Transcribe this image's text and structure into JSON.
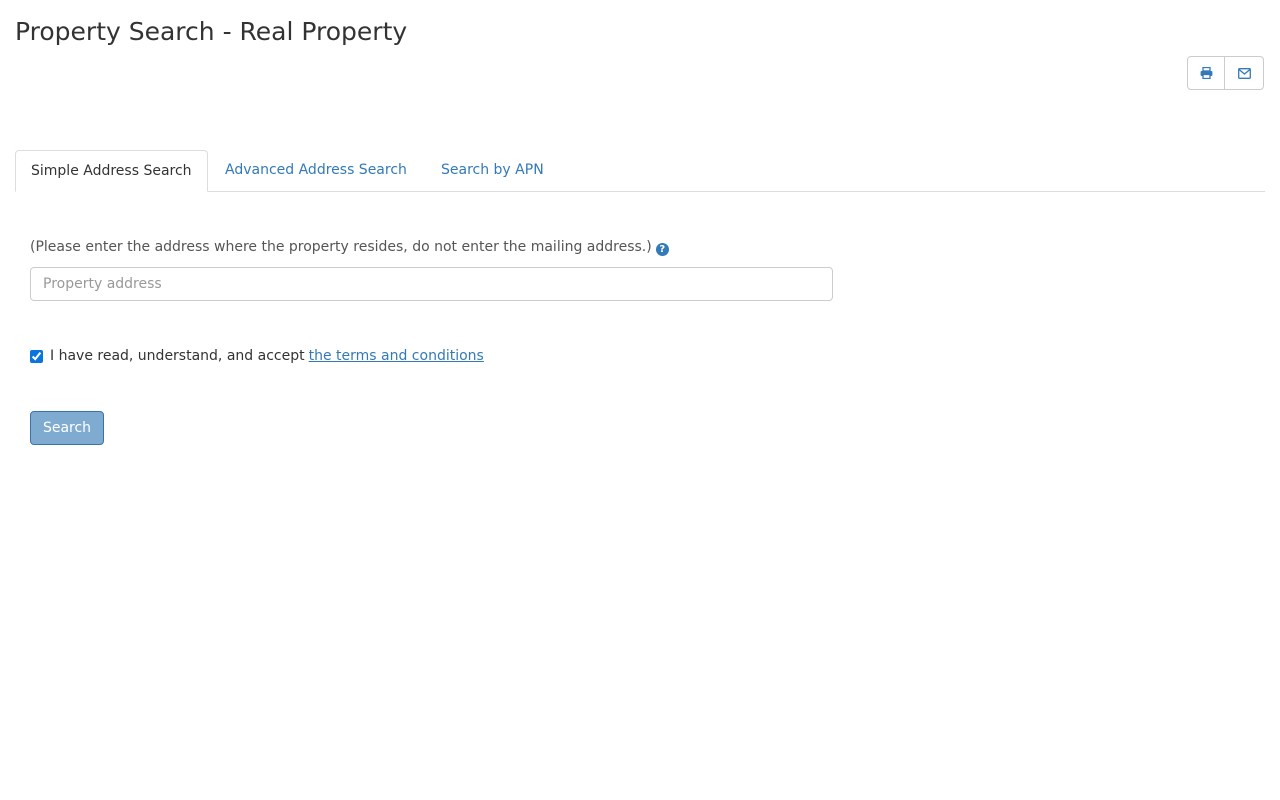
{
  "page": {
    "title": "Property Search - Real Property"
  },
  "actions": {
    "print_icon": "print-icon",
    "email_icon": "envelope-icon"
  },
  "tabs": [
    {
      "label": "Simple Address Search",
      "active": true
    },
    {
      "label": "Advanced Address Search",
      "active": false
    },
    {
      "label": "Search by APN",
      "active": false
    }
  ],
  "form": {
    "hint": "(Please enter the address where the property resides, do not enter the mailing address.)",
    "help_icon": "question-circle-icon",
    "help_glyph": "?",
    "address_placeholder": "Property address",
    "address_value": "",
    "terms_checked": true,
    "terms_text": "I have read, understand, and accept",
    "terms_link": "the terms and conditions",
    "search_label": "Search"
  },
  "colors": {
    "link": "#337ab7",
    "primary_disabled": "#7aa7cf",
    "text": "#333333",
    "border": "#dddddd"
  }
}
